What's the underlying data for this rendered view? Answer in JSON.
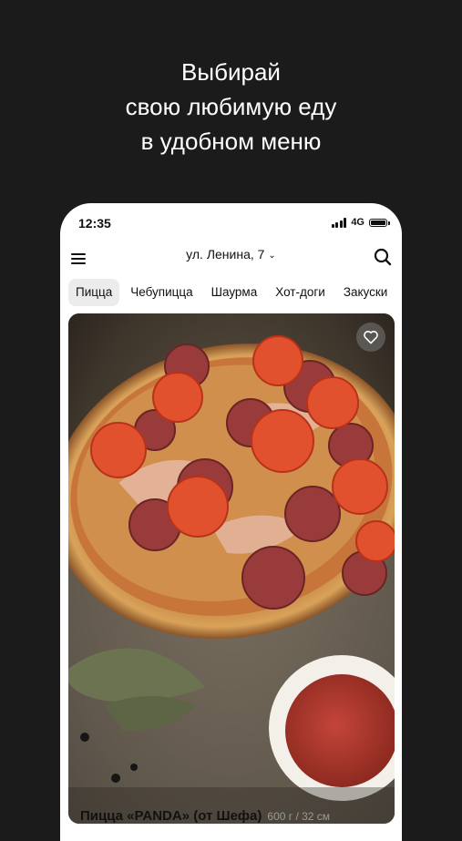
{
  "promo": {
    "line1": "Выбирай",
    "line2": "свою любимую еду",
    "line3": "в удобном меню"
  },
  "statusbar": {
    "time": "12:35",
    "network": "4G",
    "icons": [
      "signal-icon",
      "battery-icon"
    ]
  },
  "header": {
    "address": "ул. Ленина, 7",
    "icons": [
      "menu-icon",
      "chevron-down-icon",
      "search-icon"
    ]
  },
  "categories": [
    {
      "label": "Пицца",
      "active": true
    },
    {
      "label": "Чебупицца",
      "active": false
    },
    {
      "label": "Шаурма",
      "active": false
    },
    {
      "label": "Хот-доги",
      "active": false
    },
    {
      "label": "Закуски",
      "active": false
    }
  ],
  "product": {
    "title": "Пицца «PANDA» (от Шефа)",
    "meta": "600 г / 32 см",
    "icons": [
      "heart-icon"
    ]
  },
  "colors": {
    "background": "#1b1b1b",
    "phone": "#ffffff",
    "active_tab": "#ececec",
    "text": "#111111"
  }
}
